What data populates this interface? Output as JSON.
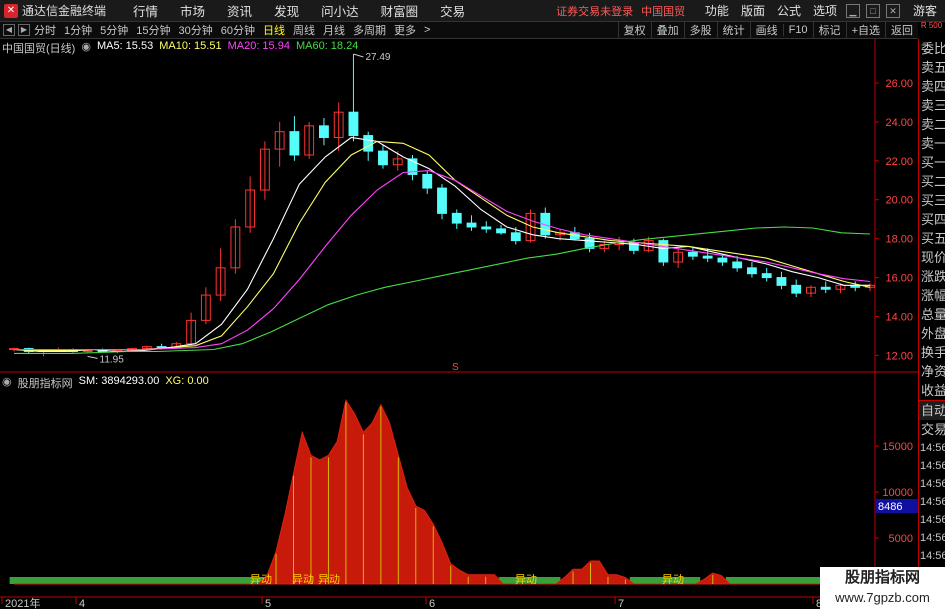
{
  "titlebar": {
    "app_title": "通达信金融终端",
    "menus": [
      "行情",
      "市场",
      "资讯",
      "发现",
      "问小达",
      "财富圈",
      "交易"
    ],
    "trade_status": "证券交易未登录",
    "stock_title": "中国国贸",
    "right_menus": [
      "功能",
      "版面",
      "公式",
      "选项"
    ],
    "guest": "游客"
  },
  "toolbar": {
    "periods": [
      "分时",
      "1分钟",
      "5分钟",
      "15分钟",
      "30分钟",
      "60分钟",
      "日线",
      "周线",
      "月线",
      "多周期",
      "更多"
    ],
    "active_period": "日线",
    "buttons": [
      "复权",
      "叠加",
      "多股",
      "统计",
      "画线",
      "F10",
      "标记",
      "+自选",
      "返回"
    ],
    "r500": "R 500"
  },
  "main_legend": {
    "title": "中国国贸(日线)",
    "ma5": "MA5: 15.53",
    "ma10": "MA10: 15.51",
    "ma20": "MA20: 15.94",
    "ma60": "MA60: 18.24",
    "colors": {
      "ma5": "#ffffff",
      "ma10": "#ffff66",
      "ma20": "#ff44ff",
      "ma60": "#44dd44",
      "up": "#ff3333",
      "down": "#54fcfc"
    }
  },
  "sub_legend": {
    "title": "股朋指标网",
    "sm": "SM: 3894293.00",
    "xg": "XG: 0.00"
  },
  "chart_data": {
    "type": "line",
    "main_axis": {
      "ticks": [
        "26.00",
        "24.00",
        "22.00",
        "20.00",
        "18.00",
        "16.00",
        "14.00",
        "12.00"
      ],
      "ylim": [
        11.3,
        27.8
      ]
    },
    "high_label": "27.49",
    "low_label": "11.95",
    "sub_axis": {
      "ticks": [
        "15000",
        "10000",
        "5000"
      ],
      "ylim": [
        0,
        21000
      ]
    },
    "current_value_label": "8486",
    "x_labels": [
      "2021年",
      "4",
      "5",
      "6",
      "7",
      "8"
    ],
    "signal_labels": [
      "异动",
      "异动",
      "异动",
      "异动",
      "异动"
    ],
    "marker": "S",
    "series": [
      {
        "name": "MA5",
        "values": [
          12.3,
          12.2,
          12.2,
          12.3,
          12.2,
          12.25,
          12.4,
          12.6,
          13.6,
          15.4,
          18.0,
          20.8,
          22.2,
          23.2,
          23.0,
          22.2,
          21.6,
          20.7,
          19.5,
          18.6,
          18.2,
          18.0,
          17.9,
          17.8,
          17.7,
          17.5,
          17.6,
          17.3,
          17.0,
          16.7,
          16.3,
          16.0,
          15.6,
          15.6
        ]
      },
      {
        "name": "MA10",
        "values": [
          12.3,
          12.25,
          12.25,
          12.3,
          12.3,
          12.3,
          12.4,
          12.5,
          13.0,
          14.5,
          16.2,
          18.8,
          20.9,
          22.3,
          23.0,
          22.9,
          22.3,
          21.0,
          20.1,
          19.2,
          18.6,
          18.3,
          18.1,
          17.9,
          17.8,
          17.7,
          17.6,
          17.4,
          17.2,
          17.0,
          16.6,
          16.2,
          15.8,
          15.5
        ]
      },
      {
        "name": "MA20",
        "values": [
          12.3,
          12.3,
          12.3,
          12.3,
          12.3,
          12.3,
          12.35,
          12.4,
          12.6,
          13.3,
          14.4,
          15.9,
          17.6,
          19.2,
          20.5,
          21.4,
          21.5,
          21.0,
          20.2,
          19.4,
          18.9,
          18.5,
          18.2,
          18.0,
          17.8,
          17.6,
          17.4,
          17.2,
          17.0,
          16.8,
          16.5,
          16.2,
          15.94,
          15.8
        ]
      },
      {
        "name": "MA60",
        "values": [
          12.1,
          12.1,
          12.1,
          12.15,
          12.2,
          12.2,
          12.25,
          12.3,
          12.6,
          13.2,
          13.9,
          14.6,
          15.1,
          15.5,
          15.8,
          16.1,
          16.4,
          16.7,
          17.0,
          17.2,
          17.5,
          17.75,
          17.95,
          18.1,
          18.25,
          18.4,
          18.55,
          18.6,
          18.55,
          18.3,
          18.24
        ]
      }
    ],
    "candles": [
      [
        12.3,
        12.4,
        12.2,
        12.35
      ],
      [
        12.35,
        12.4,
        12.1,
        12.2
      ],
      [
        12.2,
        12.3,
        11.95,
        12.25
      ],
      [
        12.25,
        12.4,
        12.2,
        12.3
      ],
      [
        12.3,
        12.35,
        12.15,
        12.2
      ],
      [
        12.2,
        12.3,
        12.1,
        12.25
      ],
      [
        12.25,
        12.35,
        12.15,
        12.2
      ],
      [
        12.2,
        12.3,
        12.1,
        12.25
      ],
      [
        12.25,
        12.4,
        12.2,
        12.35
      ],
      [
        12.35,
        12.5,
        12.3,
        12.45
      ],
      [
        12.45,
        12.6,
        12.3,
        12.4
      ],
      [
        12.4,
        12.7,
        12.35,
        12.6
      ],
      [
        12.6,
        14.2,
        12.5,
        13.8
      ],
      [
        13.8,
        15.5,
        13.6,
        15.1
      ],
      [
        15.1,
        17.5,
        14.8,
        16.5
      ],
      [
        16.5,
        19.0,
        16.2,
        18.6
      ],
      [
        18.6,
        21.2,
        18.3,
        20.5
      ],
      [
        20.5,
        23.0,
        20.0,
        22.6
      ],
      [
        22.6,
        24.0,
        21.7,
        23.5
      ],
      [
        23.5,
        24.3,
        22.0,
        22.3
      ],
      [
        22.3,
        24.0,
        22.1,
        23.8
      ],
      [
        23.8,
        24.2,
        22.8,
        23.2
      ],
      [
        23.2,
        25.0,
        22.5,
        24.5
      ],
      [
        24.5,
        27.49,
        23.0,
        23.3
      ],
      [
        23.3,
        23.5,
        22.0,
        22.5
      ],
      [
        22.5,
        22.8,
        21.6,
        21.8
      ],
      [
        21.8,
        22.5,
        21.5,
        22.1
      ],
      [
        22.1,
        22.3,
        21.0,
        21.3
      ],
      [
        21.3,
        21.5,
        20.3,
        20.6
      ],
      [
        20.6,
        20.8,
        19.0,
        19.3
      ],
      [
        19.3,
        19.5,
        18.5,
        18.8
      ],
      [
        18.8,
        19.2,
        18.4,
        18.6
      ],
      [
        18.6,
        18.9,
        18.3,
        18.5
      ],
      [
        18.5,
        18.7,
        18.2,
        18.3
      ],
      [
        18.3,
        18.6,
        17.7,
        17.9
      ],
      [
        17.9,
        19.5,
        17.8,
        19.3
      ],
      [
        19.3,
        19.6,
        18.0,
        18.2
      ],
      [
        18.2,
        18.5,
        17.9,
        18.3
      ],
      [
        18.3,
        18.6,
        17.9,
        18.0
      ],
      [
        18.0,
        18.3,
        17.3,
        17.5
      ],
      [
        17.5,
        17.9,
        17.3,
        17.7
      ],
      [
        17.7,
        18.1,
        17.4,
        17.8
      ],
      [
        17.8,
        18.0,
        17.2,
        17.4
      ],
      [
        17.4,
        18.1,
        17.3,
        17.9
      ],
      [
        17.9,
        18.0,
        16.6,
        16.8
      ],
      [
        16.8,
        17.5,
        16.5,
        17.3
      ],
      [
        17.3,
        17.6,
        16.9,
        17.1
      ],
      [
        17.1,
        17.5,
        16.8,
        17.0
      ],
      [
        17.0,
        17.2,
        16.6,
        16.8
      ],
      [
        16.8,
        17.1,
        16.3,
        16.5
      ],
      [
        16.5,
        16.8,
        16.0,
        16.2
      ],
      [
        16.2,
        16.5,
        15.8,
        16.0
      ],
      [
        16.0,
        16.3,
        15.4,
        15.6
      ],
      [
        15.6,
        15.9,
        15.0,
        15.2
      ],
      [
        15.2,
        15.6,
        15.0,
        15.5
      ],
      [
        15.5,
        15.8,
        15.2,
        15.4
      ],
      [
        15.4,
        15.7,
        15.2,
        15.6
      ],
      [
        15.6,
        15.8,
        15.3,
        15.5
      ],
      [
        15.5,
        15.7,
        15.3,
        15.6
      ]
    ],
    "sub_series": [
      {
        "name": "SM",
        "values": [
          0,
          0,
          0,
          0,
          0,
          0,
          0,
          0,
          0,
          0,
          0,
          0,
          0,
          0,
          0,
          0,
          0,
          0,
          0,
          0,
          0,
          0,
          0,
          0,
          0,
          0,
          0,
          0,
          0,
          1000,
          3500,
          7500,
          12000,
          16500,
          14000,
          13500,
          14000,
          15500,
          20000,
          18500,
          16500,
          17500,
          19500,
          17500,
          14000,
          10500,
          8500,
          8000,
          6500,
          4500,
          2200,
          1500,
          1000,
          1000,
          1000,
          1000,
          0,
          0,
          0,
          0,
          0,
          0,
          0,
          700,
          1600,
          1600,
          2500,
          2500,
          1000,
          1000,
          700,
          0,
          0,
          0,
          0,
          0,
          0,
          0,
          0,
          500,
          1200,
          900,
          0,
          0,
          0,
          0,
          0,
          0,
          0,
          0,
          0,
          0,
          0,
          0,
          0,
          0,
          0,
          0,
          0
        ]
      }
    ]
  },
  "right_panel": {
    "quote_labels": [
      "委比",
      "卖五",
      "卖四",
      "卖三",
      "卖二",
      "卖一",
      "买一",
      "买二",
      "买三",
      "买四",
      "买五",
      "现价",
      "涨跌",
      "涨幅",
      "总量",
      "外盘",
      "换手",
      "净资",
      "收益"
    ],
    "tab_labels": [
      "自动",
      "交易"
    ],
    "times": [
      "14:56",
      "14:56",
      "14:56",
      "14:56",
      "14:56",
      "14:56",
      "14:56",
      "14:56",
      "14:56",
      "14:56"
    ]
  },
  "watermark": {
    "title": "股朋指标网",
    "url": "www.7gpzb.com"
  }
}
